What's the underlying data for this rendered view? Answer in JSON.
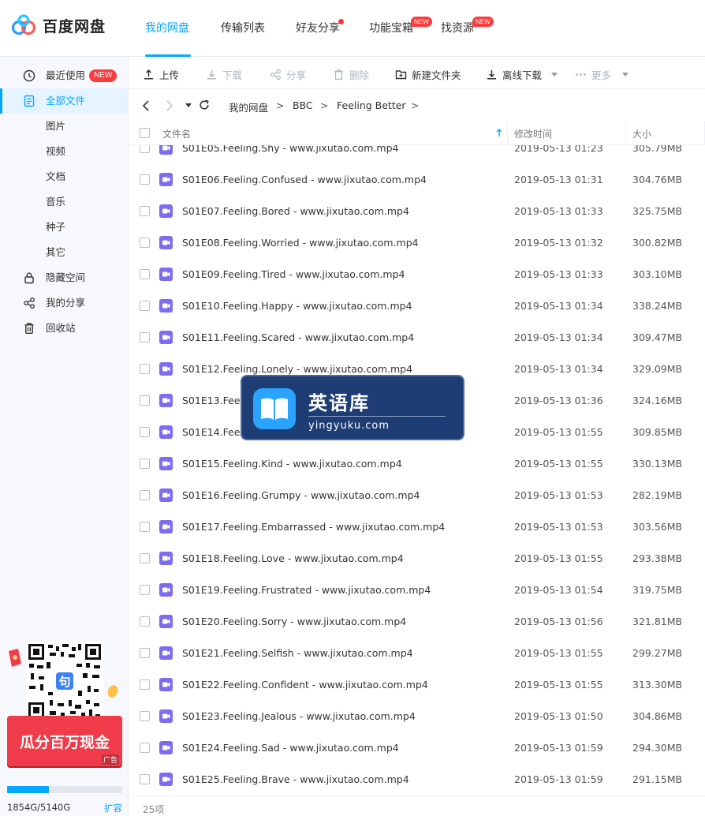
{
  "app": {
    "logo_text": "百度网盘"
  },
  "nav": {
    "tabs": [
      {
        "label": "我的网盘",
        "active": true
      },
      {
        "label": "传输列表"
      },
      {
        "label": "好友分享"
      },
      {
        "label": "功能宝箱"
      },
      {
        "label": "找资源"
      }
    ],
    "badge_new": "NEW"
  },
  "sidebar": {
    "items": [
      {
        "label": "最近使用",
        "badge": "NEW"
      },
      {
        "label": "全部文件",
        "active": true
      },
      {
        "label": "图片"
      },
      {
        "label": "视频"
      },
      {
        "label": "文档"
      },
      {
        "label": "音乐"
      },
      {
        "label": "种子"
      },
      {
        "label": "其它"
      },
      {
        "label": "隐藏空间"
      },
      {
        "label": "我的分享"
      },
      {
        "label": "回收站"
      }
    ],
    "ad": {
      "title": "瓜分百万现金",
      "tag": "广告",
      "qr_char": "句"
    },
    "quota": {
      "text": "1854G/5140G",
      "used_fraction": 0.36,
      "expand": "扩容"
    }
  },
  "toolbar": {
    "upload": "上传",
    "download": "下载",
    "share": "分享",
    "delete": "删除",
    "new_folder": "新建文件夹",
    "offline_download": "离线下载",
    "more": "更多"
  },
  "path": {
    "segments": [
      "我的网盘",
      "BBC",
      "Feeling Better"
    ],
    "sep": ">"
  },
  "table": {
    "columns": {
      "name": "文件名",
      "modified": "修改时间",
      "size": "大小"
    },
    "rows": [
      {
        "name": "S01E05.Feeling.Shy - www.jixutao.com.mp4",
        "date": "2019-05-13 01:23",
        "size": "305.79MB"
      },
      {
        "name": "S01E06.Feeling.Confused - www.jixutao.com.mp4",
        "date": "2019-05-13 01:31",
        "size": "304.76MB"
      },
      {
        "name": "S01E07.Feeling.Bored - www.jixutao.com.mp4",
        "date": "2019-05-13 01:33",
        "size": "325.75MB"
      },
      {
        "name": "S01E08.Feeling.Worried - www.jixutao.com.mp4",
        "date": "2019-05-13 01:32",
        "size": "300.82MB"
      },
      {
        "name": "S01E09.Feeling.Tired - www.jixutao.com.mp4",
        "date": "2019-05-13 01:33",
        "size": "303.10MB"
      },
      {
        "name": "S01E10.Feeling.Happy - www.jixutao.com.mp4",
        "date": "2019-05-13 01:34",
        "size": "338.24MB"
      },
      {
        "name": "S01E11.Feeling.Scared - www.jixutao.com.mp4",
        "date": "2019-05-13 01:34",
        "size": "309.47MB"
      },
      {
        "name": "S01E12.Feeling.Lonely - www.jixutao.com.mp4",
        "date": "2019-05-13 01:34",
        "size": "329.09MB"
      },
      {
        "name": "S01E13.Feeli",
        "date": "2019-05-13 01:36",
        "size": "324.16MB"
      },
      {
        "name": "S01E14.Feeli",
        "date": "2019-05-13 01:55",
        "size": "309.85MB"
      },
      {
        "name": "S01E15.Feeling.Kind - www.jixutao.com.mp4",
        "date": "2019-05-13 01:55",
        "size": "330.13MB"
      },
      {
        "name": "S01E16.Feeling.Grumpy - www.jixutao.com.mp4",
        "date": "2019-05-13 01:53",
        "size": "282.19MB"
      },
      {
        "name": "S01E17.Feeling.Embarrassed - www.jixutao.com.mp4",
        "date": "2019-05-13 01:53",
        "size": "303.56MB"
      },
      {
        "name": "S01E18.Feeling.Love - www.jixutao.com.mp4",
        "date": "2019-05-13 01:55",
        "size": "293.38MB"
      },
      {
        "name": "S01E19.Feeling.Frustrated - www.jixutao.com.mp4",
        "date": "2019-05-13 01:54",
        "size": "319.75MB"
      },
      {
        "name": "S01E20.Feeling.Sorry - www.jixutao.com.mp4",
        "date": "2019-05-13 01:56",
        "size": "321.81MB"
      },
      {
        "name": "S01E21.Feeling.Selfish - www.jixutao.com.mp4",
        "date": "2019-05-13 01:55",
        "size": "299.27MB"
      },
      {
        "name": "S01E22.Feeling.Confident - www.jixutao.com.mp4",
        "date": "2019-05-13 01:55",
        "size": "313.30MB"
      },
      {
        "name": "S01E23.Feeling.Jealous - www.jixutao.com.mp4",
        "date": "2019-05-13 01:50",
        "size": "304.86MB"
      },
      {
        "name": "S01E24.Feeling.Sad - www.jixutao.com.mp4",
        "date": "2019-05-13 01:59",
        "size": "294.30MB"
      },
      {
        "name": "S01E25.Feeling.Brave - www.jixutao.com.mp4",
        "date": "2019-05-13 01:59",
        "size": "291.15MB"
      }
    ],
    "count": "25项"
  },
  "watermark": {
    "title": "英语库",
    "url": "yingyuku.com"
  },
  "colors": {
    "accent": "#06a7ff",
    "badge_red": "#fa3c3c",
    "video_icon": "#7c6cf0"
  }
}
